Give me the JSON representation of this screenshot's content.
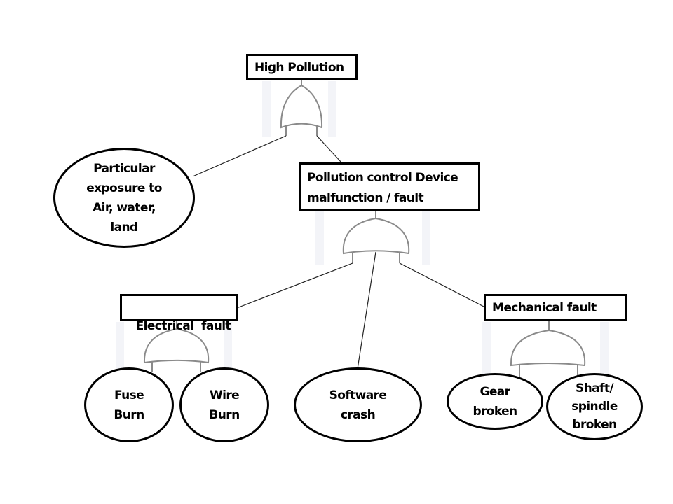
{
  "diagram": {
    "type": "fault-tree",
    "nodes": {
      "top": {
        "label": "High Pollution",
        "shape": "rectangle",
        "gate": "OR"
      },
      "exposure": {
        "label_lines": [
          "Particular",
          "exposure to",
          "Air, water,",
          "land"
        ],
        "shape": "ellipse"
      },
      "device": {
        "label_lines": [
          "Pollution control Device",
          "malfunction / fault"
        ],
        "shape": "rectangle",
        "gate": "AND"
      },
      "electrical": {
        "label": "Electrical  fault",
        "shape": "rectangle",
        "gate": "AND"
      },
      "software": {
        "label_lines": [
          "Software",
          "crash"
        ],
        "shape": "ellipse"
      },
      "mechanical": {
        "label": "Mechanical fault",
        "shape": "rectangle",
        "gate": "AND"
      },
      "fuse": {
        "label_lines": [
          "Fuse",
          "Burn"
        ],
        "shape": "ellipse"
      },
      "wire": {
        "label_lines": [
          "Wire",
          "Burn"
        ],
        "shape": "ellipse"
      },
      "gear": {
        "label_lines": [
          "Gear",
          "broken"
        ],
        "shape": "ellipse"
      },
      "shaft": {
        "label_lines": [
          "Shaft/",
          "spindle",
          "broken"
        ],
        "shape": "ellipse"
      }
    },
    "edges": [
      [
        "top",
        "exposure"
      ],
      [
        "top",
        "device"
      ],
      [
        "device",
        "electrical"
      ],
      [
        "device",
        "software"
      ],
      [
        "device",
        "mechanical"
      ],
      [
        "electrical",
        "fuse"
      ],
      [
        "electrical",
        "wire"
      ],
      [
        "mechanical",
        "gear"
      ],
      [
        "mechanical",
        "shaft"
      ]
    ]
  }
}
